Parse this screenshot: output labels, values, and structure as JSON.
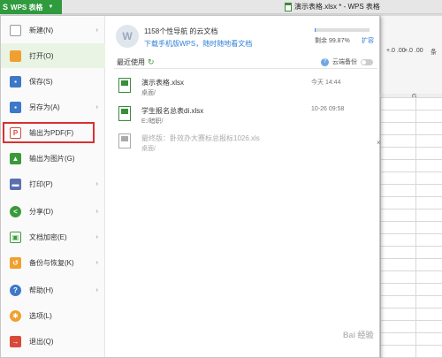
{
  "titlebar": {
    "app_button": "WPS 表格",
    "doc_title": "演示表格.xlsx * - WPS 表格"
  },
  "ribbon": {
    "items": [
      "+.0 .00",
      "+.0 .00",
      "条"
    ]
  },
  "menu": {
    "items": [
      {
        "label": "新建(N)",
        "icon": "new-doc-icon",
        "color": "#ffffff",
        "has_arrow": true
      },
      {
        "label": "打开(O)",
        "icon": "folder-open-icon",
        "color": "#f0a030",
        "has_arrow": false,
        "active": true
      },
      {
        "label": "保存(S)",
        "icon": "save-icon",
        "color": "#3d78c9",
        "has_arrow": false
      },
      {
        "label": "另存为(A)",
        "icon": "save-as-icon",
        "color": "#3d78c9",
        "has_arrow": true
      },
      {
        "label": "输出为PDF(F)",
        "icon": "pdf-icon",
        "color": "#d94a3a",
        "has_arrow": false
      },
      {
        "label": "输出为图片(G)",
        "icon": "image-icon",
        "color": "#3a9a3a",
        "has_arrow": false
      },
      {
        "label": "打印(P)",
        "icon": "printer-icon",
        "color": "#5a6fb0",
        "has_arrow": true
      },
      {
        "label": "分享(D)",
        "icon": "share-icon",
        "color": "#3a9a3a",
        "has_arrow": true
      },
      {
        "label": "文档加密(E)",
        "icon": "lock-doc-icon",
        "color": "#3a9a3a",
        "has_arrow": true
      },
      {
        "label": "备份与恢复(K)",
        "icon": "backup-icon",
        "color": "#f0a030",
        "has_arrow": true
      },
      {
        "label": "帮助(H)",
        "icon": "help-icon",
        "color": "#3d78c9",
        "has_arrow": true
      },
      {
        "label": "选项(L)",
        "icon": "gear-icon",
        "color": "#f0a030",
        "has_arrow": false
      },
      {
        "label": "退出(Q)",
        "icon": "exit-icon",
        "color": "#d94a3a",
        "has_arrow": false
      }
    ]
  },
  "cloud": {
    "name": "1158个性导航 的云文档",
    "link": "下载手机版WPS，随时随地看文档",
    "storage_label": "剩余 99.87%",
    "storage_used_percent": 0.13,
    "expand": "扩容"
  },
  "recent": {
    "header": "最近使用",
    "backup_label": "云端备份",
    "files": [
      {
        "name": "演示表格.xlsx",
        "path": "桌面/",
        "time": "今天 14:44",
        "dim": false
      },
      {
        "name": "学生报名总表di.xlsx",
        "path": "E:/暗职/",
        "time": "10-26 09:58",
        "dim": false
      },
      {
        "name": "最终版：卧效办大赛标总报标1026.xls",
        "path": "桌面/",
        "time": "",
        "dim": true
      }
    ]
  },
  "watermark": "Bai 经验"
}
